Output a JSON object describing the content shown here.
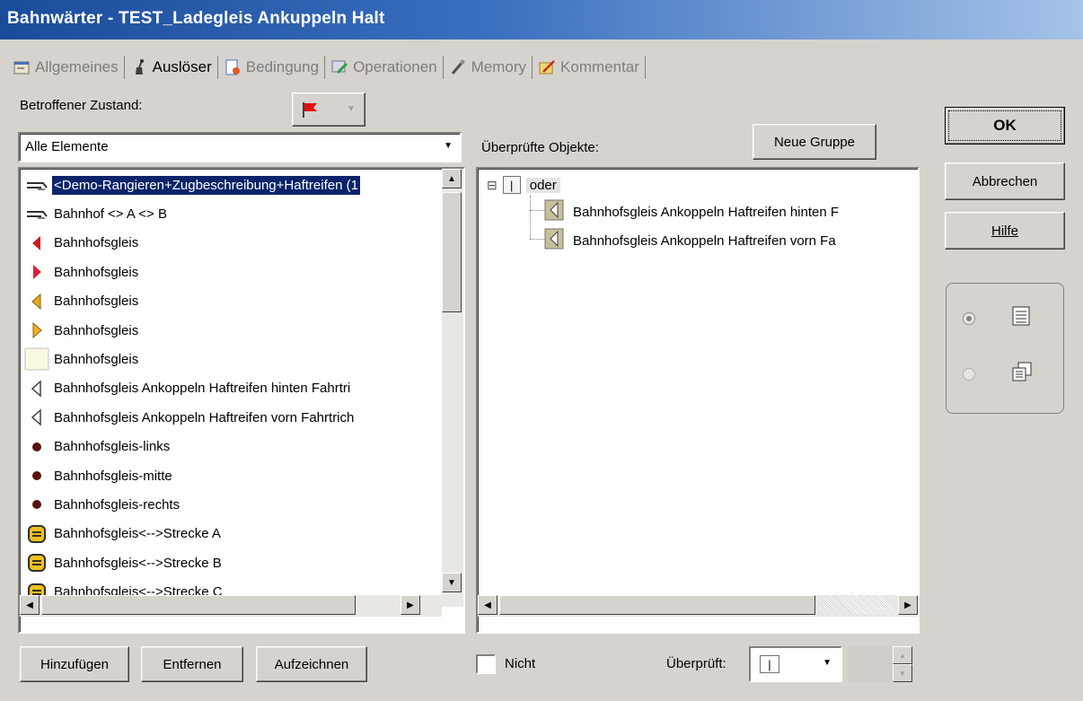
{
  "window": {
    "title": "Bahnwärter - TEST_Ladegleis Ankuppeln Halt"
  },
  "tabs": [
    {
      "label": "Allgemeines",
      "icon": "properties-icon",
      "active": false
    },
    {
      "label": "Auslöser",
      "icon": "trigger-icon",
      "active": true
    },
    {
      "label": "Bedingung",
      "icon": "condition-icon",
      "active": false
    },
    {
      "label": "Operationen",
      "icon": "operations-icon",
      "active": false
    },
    {
      "label": "Memory",
      "icon": "memory-icon",
      "active": false
    },
    {
      "label": "Kommentar",
      "icon": "comment-icon",
      "active": false
    }
  ],
  "left": {
    "state_label": "Betroffener Zustand:",
    "filter_value": "Alle Elemente",
    "items": [
      {
        "label": "<Demo-Rangieren+Zugbeschreibung+Haftreifen (1",
        "icon": "track-group-icon",
        "selected": true
      },
      {
        "label": "Bahnhof <> A <> B",
        "icon": "track-group-icon"
      },
      {
        "label": "Bahnhofsgleis",
        "icon": "arrow-left-red-icon"
      },
      {
        "label": "Bahnhofsgleis",
        "icon": "arrow-right-red-icon"
      },
      {
        "label": "Bahnhofsgleis",
        "icon": "arrow-left-yellow-icon"
      },
      {
        "label": "Bahnhofsgleis",
        "icon": "arrow-right-yellow-icon"
      },
      {
        "label": "Bahnhofsgleis",
        "icon": "blank-box-icon"
      },
      {
        "label": "Bahnhofsgleis  Ankoppeln Haftreifen hinten Fahrtri",
        "icon": "arrow-left-gray-icon"
      },
      {
        "label": "Bahnhofsgleis  Ankoppeln Haftreifen vorn Fahrtrich",
        "icon": "arrow-left-gray-icon"
      },
      {
        "label": "Bahnhofsgleis-links",
        "icon": "dot-icon"
      },
      {
        "label": "Bahnhofsgleis-mitte",
        "icon": "dot-icon"
      },
      {
        "label": "Bahnhofsgleis-rechts",
        "icon": "dot-icon"
      },
      {
        "label": "Bahnhofsgleis<-->Strecke A",
        "icon": "switch-icon"
      },
      {
        "label": "Bahnhofsgleis<-->Strecke B",
        "icon": "switch-icon"
      },
      {
        "label": "Bahnhofsgleis<-->Strecke C",
        "icon": "switch-icon"
      }
    ],
    "buttons": {
      "add": "Hinzufügen",
      "remove": "Entfernen",
      "record": "Aufzeichnen"
    }
  },
  "right": {
    "checked_label": "Überprüfte Objekte:",
    "new_group": "Neue Gruppe",
    "tree": {
      "root_toggle": "⊟",
      "root_badge": "|",
      "root_label": "oder",
      "children": [
        {
          "label": "Bahnhofsgleis  Ankoppeln Haftreifen hinten F"
        },
        {
          "label": "Bahnhofsgleis  Ankoppeln Haftreifen vorn Fa"
        }
      ]
    },
    "not_label": "Nicht",
    "checked_by_label": "Überprüft:",
    "checked_by_value": "|"
  },
  "side": {
    "ok": "OK",
    "cancel": "Abbrechen",
    "help": "Hilfe"
  },
  "colors": {
    "selection": "#0a246a",
    "face": "#d6d3ce",
    "title_start": "#1a4c9a"
  }
}
